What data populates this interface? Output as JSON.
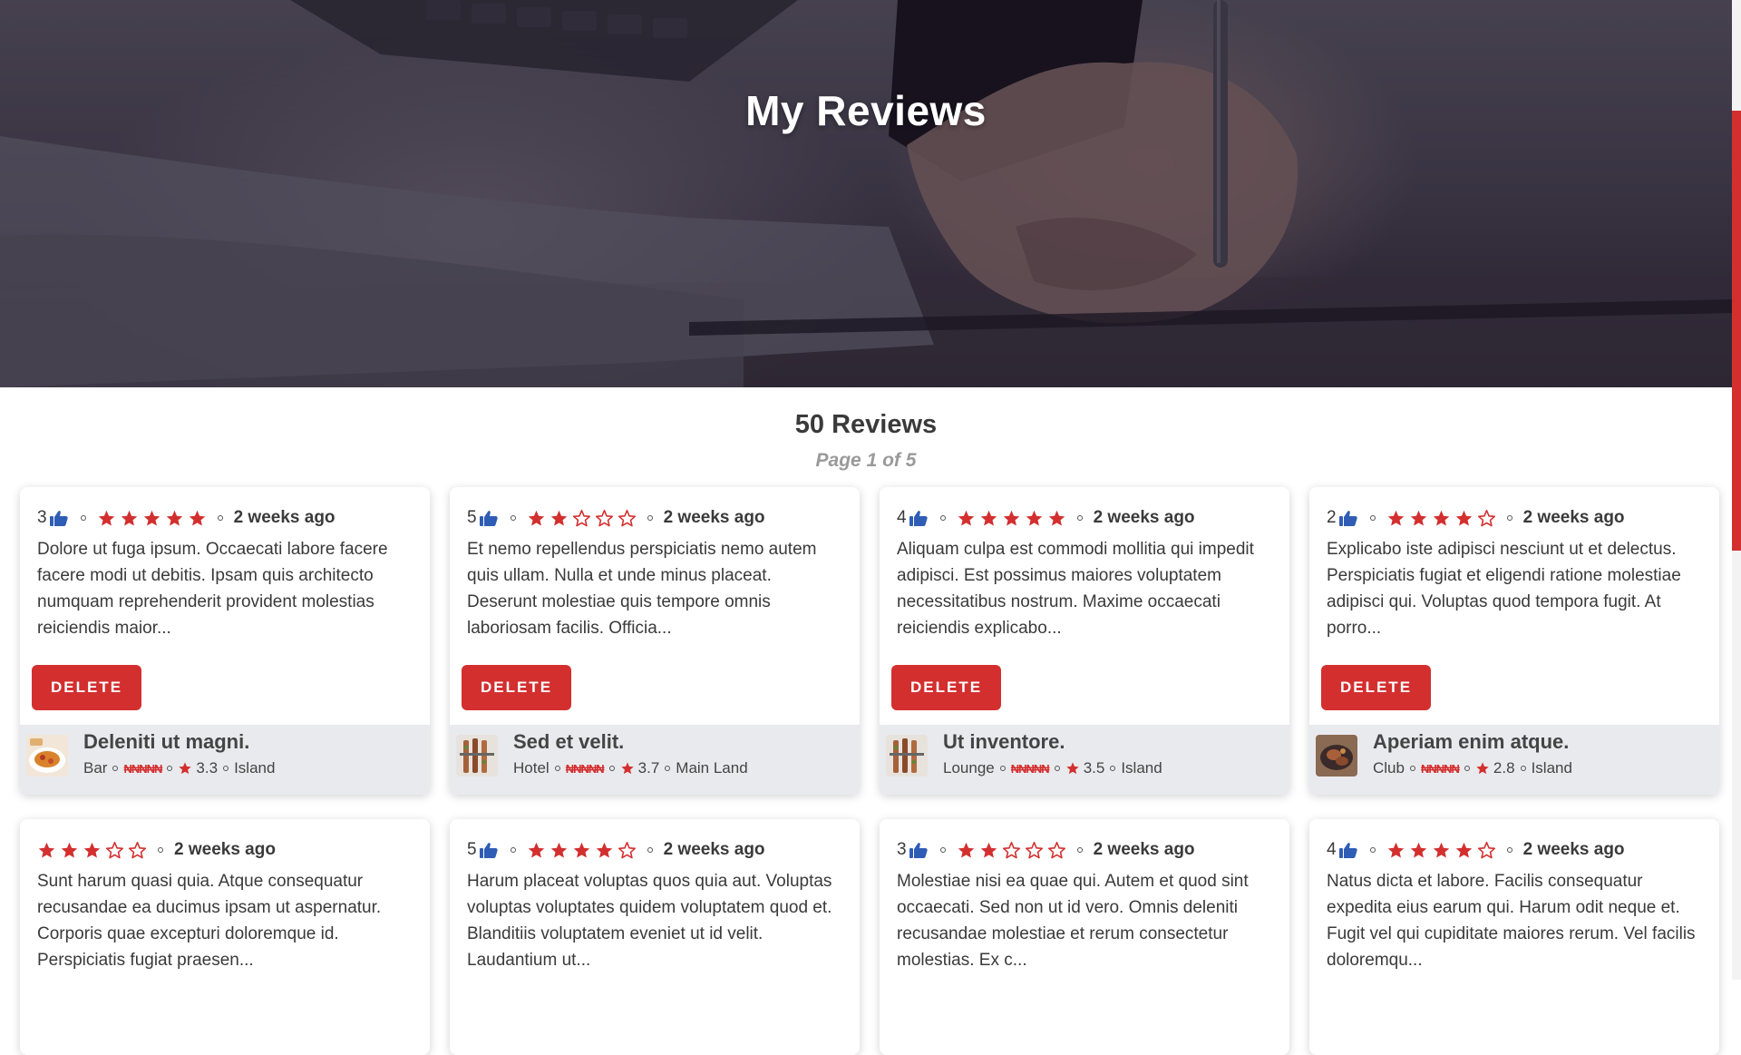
{
  "hero": {
    "title": "My Reviews"
  },
  "summary": {
    "count_text": "50 Reviews",
    "page_text": "Page 1 of 5"
  },
  "colors": {
    "accent": "#d32f2f",
    "thumb": "#2f5db5",
    "card_footer": "#e9eaee"
  },
  "delete_label": "DELETE",
  "reviews": [
    {
      "likes": "3",
      "rating": 5,
      "ago": "2 weeks ago",
      "text": "Dolore ut fuga ipsum. Occaecati labore facere facere modi ut debitis. Ipsam quis architecto numquam reprehenderit provident molestias reiciendis maior...",
      "venue": {
        "name": "Deleniti ut magni.",
        "type": "Bar",
        "price": "₦₦₦₦₦",
        "score": "3.3",
        "location": "Island",
        "image": "food-plate"
      }
    },
    {
      "likes": "5",
      "rating": 2,
      "ago": "2 weeks ago",
      "text": "Et nemo repellendus perspiciatis nemo autem quis ullam. Nulla et unde minus placeat. Deserunt molestiae quis tempore omnis laboriosam facilis. Officia...",
      "venue": {
        "name": "Sed et velit.",
        "type": "Hotel",
        "price": "₦₦₦₦₦",
        "score": "3.7",
        "location": "Main Land",
        "image": "skewers"
      }
    },
    {
      "likes": "4",
      "rating": 5,
      "ago": "2 weeks ago",
      "text": "Aliquam culpa est commodi mollitia qui impedit adipisci. Est possimus maiores voluptatem necessitatibus nostrum. Maxime occaecati reiciendis explicabo...",
      "venue": {
        "name": "Ut inventore.",
        "type": "Lounge",
        "price": "₦₦₦₦₦",
        "score": "3.5",
        "location": "Island",
        "image": "skewers"
      }
    },
    {
      "likes": "2",
      "rating": 4,
      "ago": "2 weeks ago",
      "text": "Explicabo iste adipisci nesciunt ut et delectus. Perspiciatis fugiat et eligendi ratione molestiae adipisci qui. Voluptas quod tempora fugit. At porro...",
      "venue": {
        "name": "Aperiam enim atque.",
        "type": "Club",
        "price": "₦₦₦₦₦",
        "score": "2.8",
        "location": "Island",
        "image": "grill"
      }
    },
    {
      "likes": "",
      "rating": 3,
      "ago": "2 weeks ago",
      "text": "Sunt harum quasi quia. Atque consequatur recusandae ea ducimus ipsam ut aspernatur. Corporis quae excepturi doloremque id. Perspiciatis fugiat praesen..."
    },
    {
      "likes": "5",
      "rating": 4,
      "ago": "2 weeks ago",
      "text": "Harum placeat voluptas quos quia aut. Voluptas voluptas voluptates quidem voluptatem quod et. Blanditiis voluptatem eveniet ut id velit. Laudantium ut..."
    },
    {
      "likes": "3",
      "rating": 2,
      "ago": "2 weeks ago",
      "text": "Molestiae nisi ea quae qui. Autem et quod sint occaecati. Sed non ut id vero. Omnis deleniti recusandae molestiae et rerum consectetur molestias. Ex c..."
    },
    {
      "likes": "4",
      "rating": 4,
      "ago": "2 weeks ago",
      "text": "Natus dicta et labore. Facilis consequatur expedita eius earum qui. Harum odit neque et. Fugit vel qui cupiditate maiores rerum. Vel facilis doloremqu..."
    }
  ]
}
